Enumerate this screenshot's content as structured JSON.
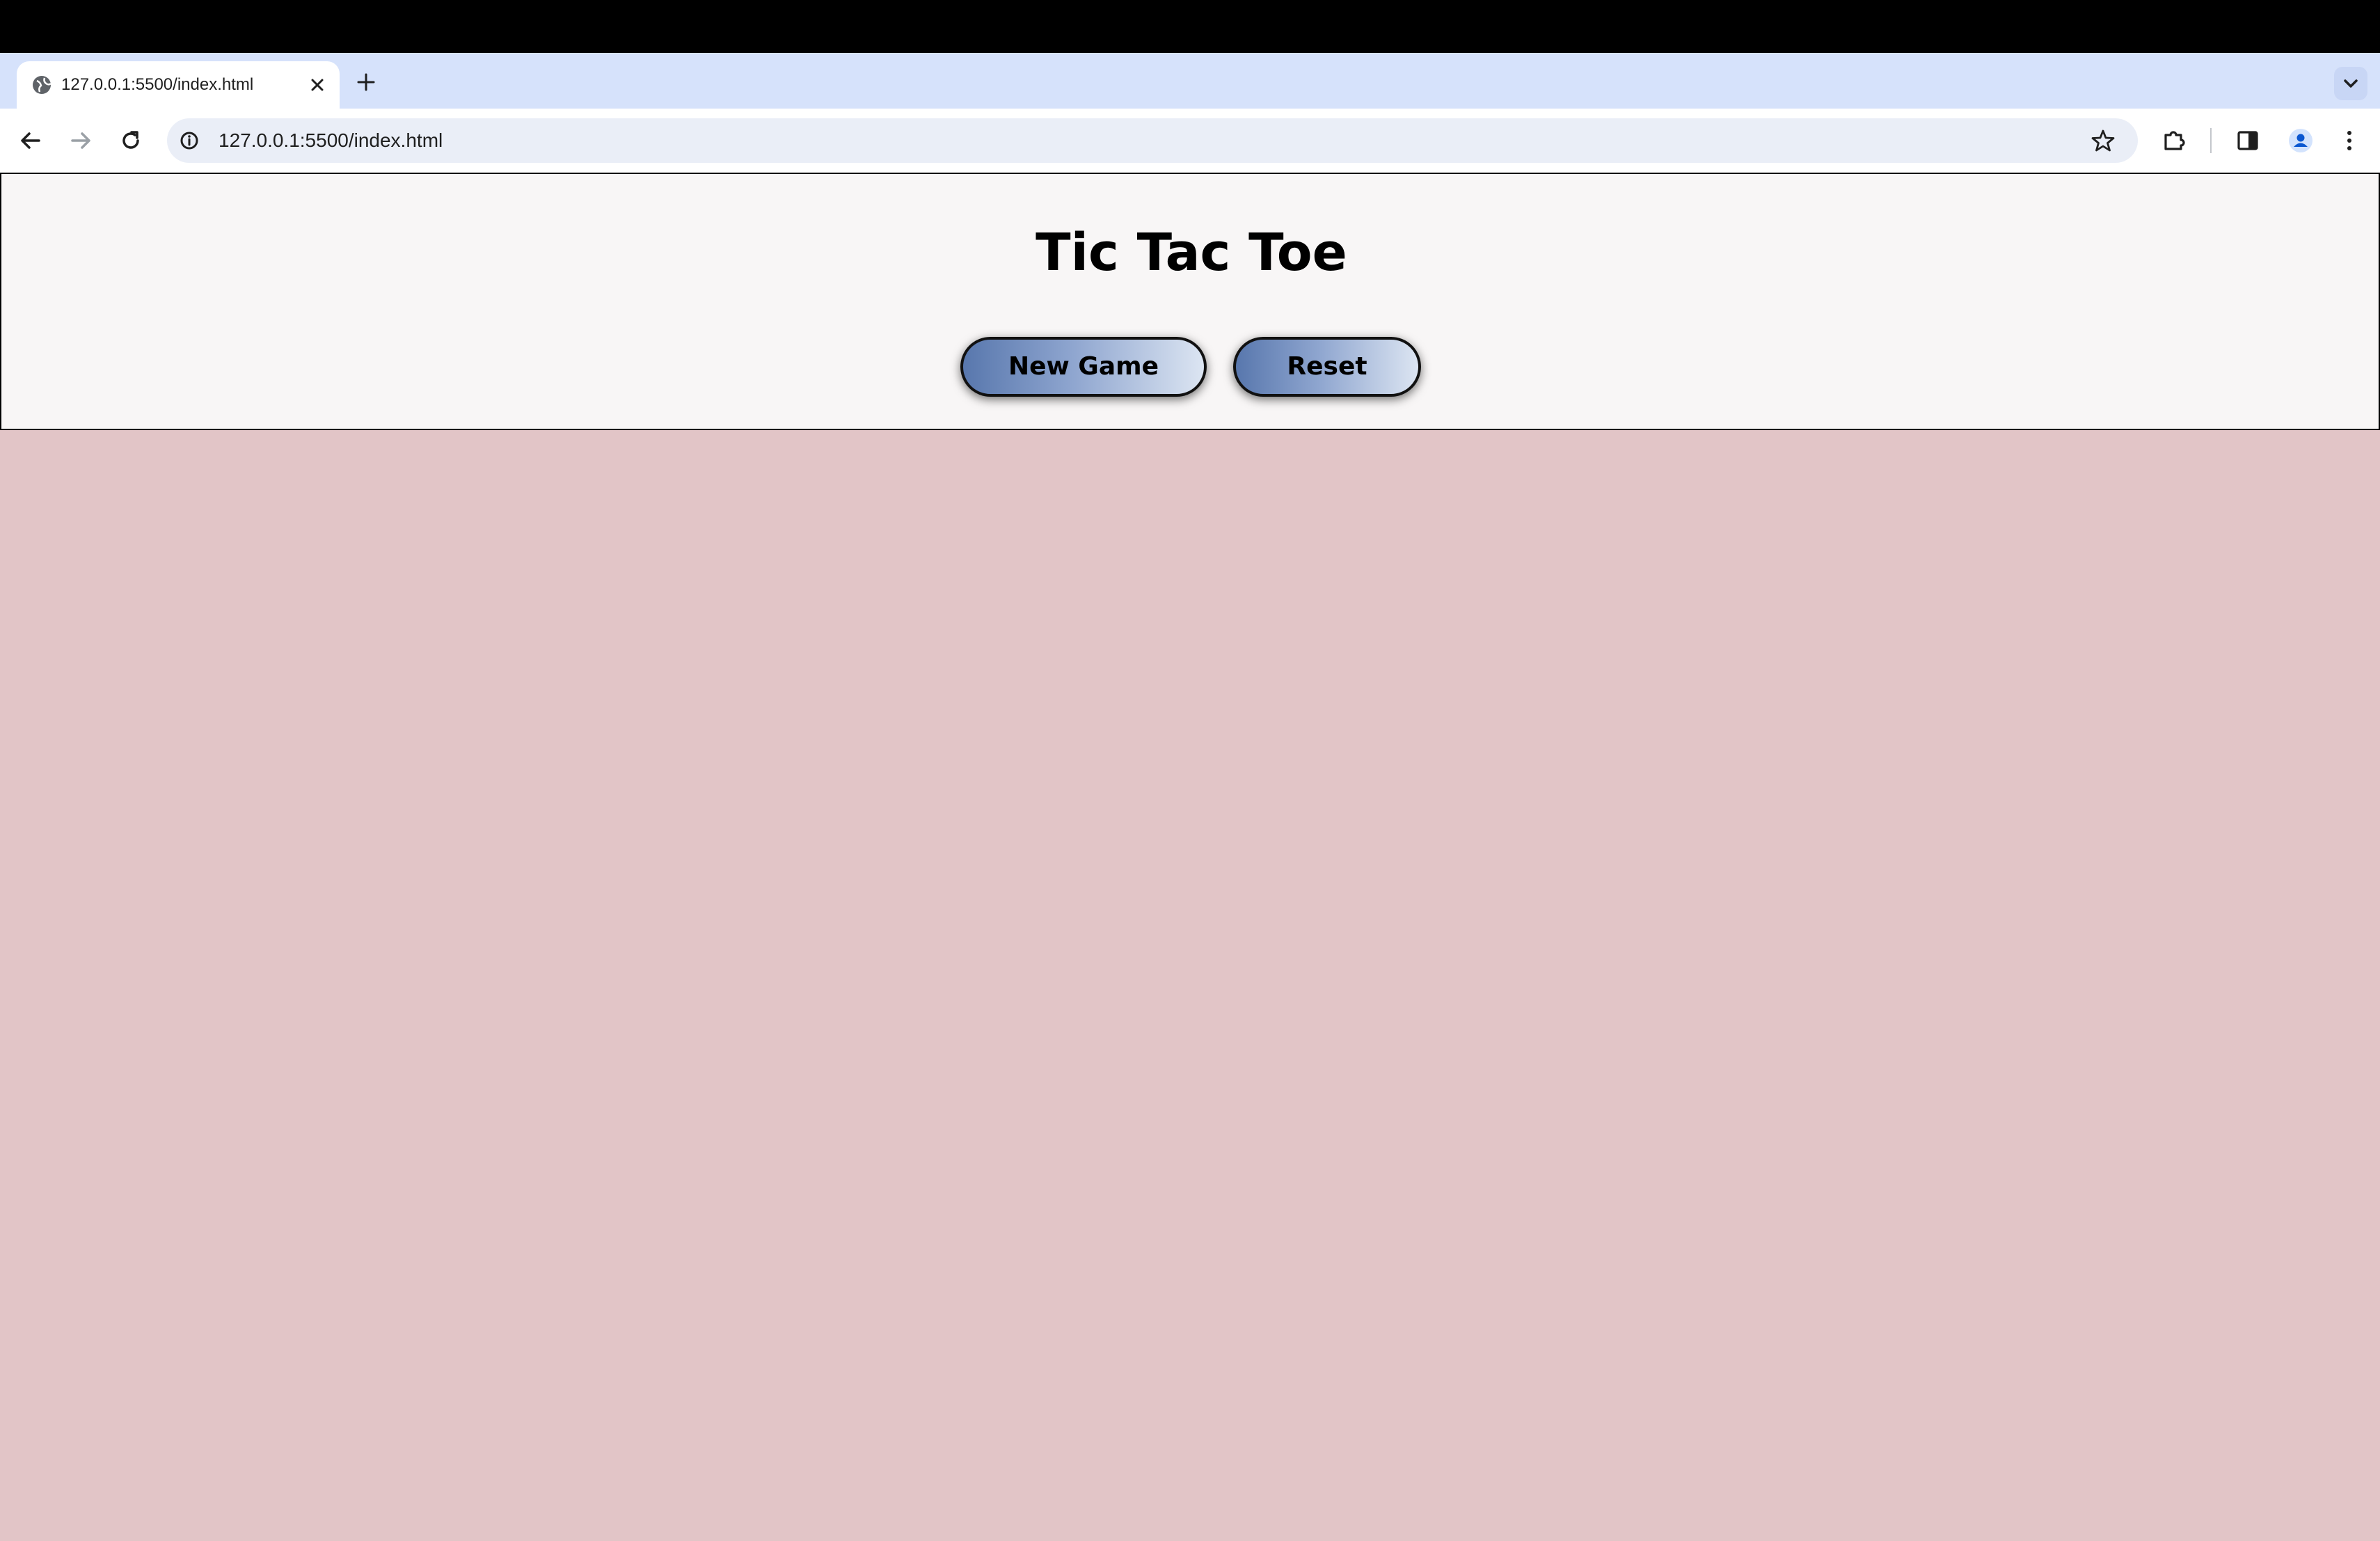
{
  "browser": {
    "tab": {
      "title": "127.0.0.1:5500/index.html"
    },
    "address_bar": {
      "url": "127.0.0.1:5500/index.html"
    }
  },
  "page": {
    "title": "Tic Tac Toe",
    "buttons": {
      "new_game": "New Game",
      "reset": "Reset"
    }
  },
  "colors": {
    "page_background": "#e2c5c7",
    "header_background": "#f8f6f6",
    "button_gradient_start": "#5877ad",
    "button_gradient_end": "#dce5f2"
  }
}
